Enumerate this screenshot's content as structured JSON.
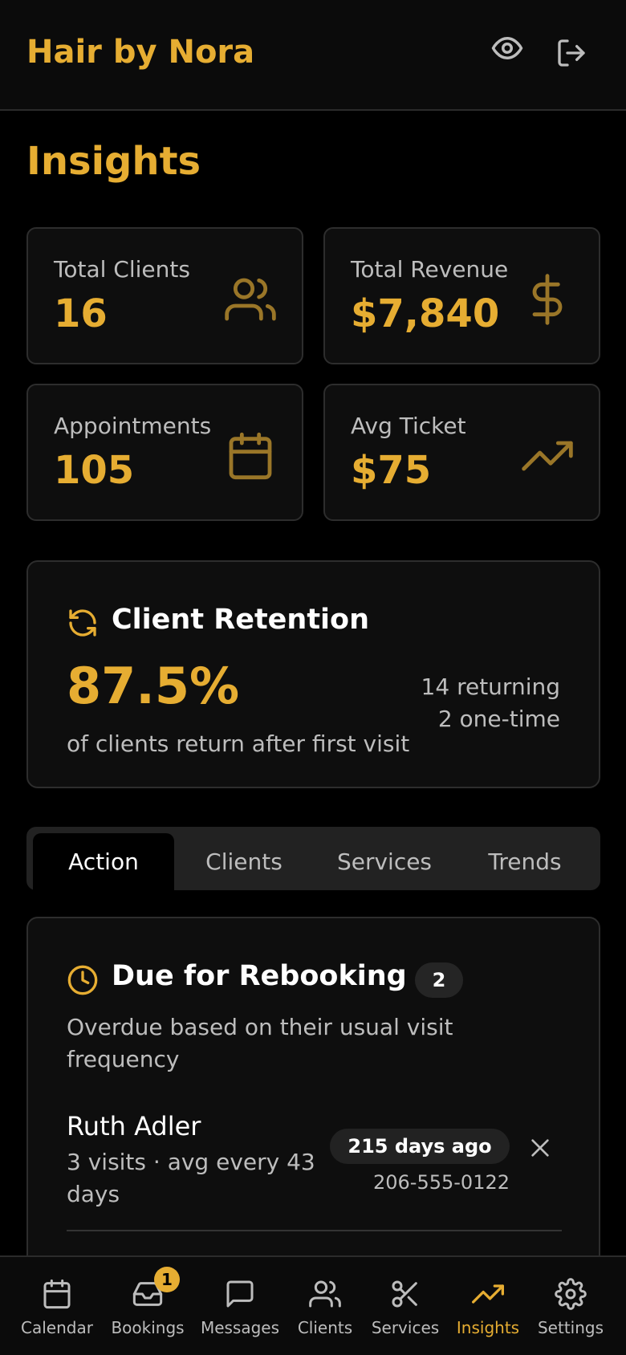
{
  "header": {
    "brand": "Hair by Nora"
  },
  "page": {
    "title": "Insights"
  },
  "stats": [
    {
      "label": "Total Clients",
      "value": "16",
      "icon": "users-icon"
    },
    {
      "label": "Total Revenue",
      "value": "$7,840",
      "icon": "dollar-icon"
    },
    {
      "label": "Appointments",
      "value": "105",
      "icon": "calendar-icon"
    },
    {
      "label": "Avg Ticket",
      "value": "$75",
      "icon": "trending-up-icon"
    }
  ],
  "retention": {
    "title": "Client Retention",
    "percent": "87.5%",
    "subtitle": "of clients return after first visit",
    "returning": "14 returning",
    "one_time": "2 one-time"
  },
  "tabs": [
    {
      "label": "Action",
      "active": true
    },
    {
      "label": "Clients",
      "active": false
    },
    {
      "label": "Services",
      "active": false
    },
    {
      "label": "Trends",
      "active": false
    }
  ],
  "rebooking": {
    "title": "Due for Rebooking",
    "count": "2",
    "description": "Overdue based on their usual visit frequency",
    "clients": [
      {
        "name": "Ruth Adler",
        "meta": "3 visits · avg every 43 days",
        "days_ago": "215 days ago",
        "phone": "206-555-0122"
      }
    ]
  },
  "nav": {
    "items": [
      {
        "label": "Calendar"
      },
      {
        "label": "Bookings",
        "badge": "1"
      },
      {
        "label": "Messages"
      },
      {
        "label": "Clients"
      },
      {
        "label": "Services"
      },
      {
        "label": "Insights",
        "active": true
      },
      {
        "label": "Settings"
      }
    ]
  },
  "colors": {
    "accent": "#e6ad32",
    "background": "#000000",
    "card": "#0e0e0e"
  }
}
